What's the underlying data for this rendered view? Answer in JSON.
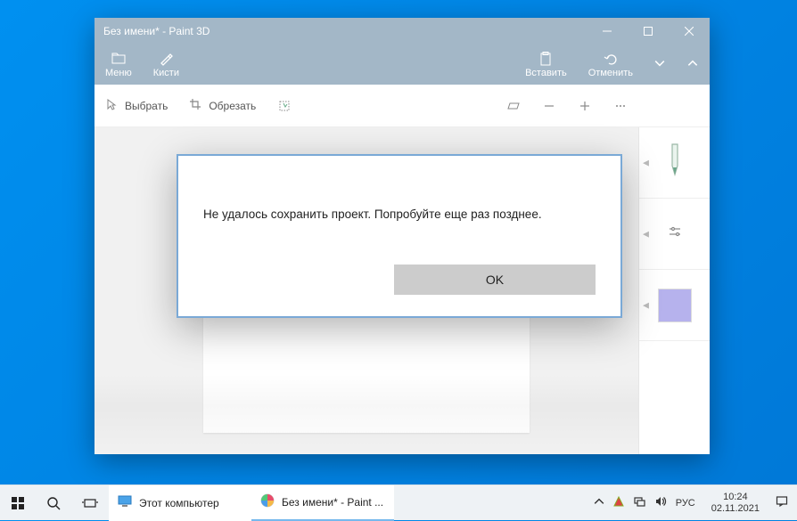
{
  "window": {
    "title": "Без имени* - Paint 3D"
  },
  "toolbar": {
    "menu": "Меню",
    "brushes": "Кисти",
    "paste": "Вставить",
    "undo": "Отменить"
  },
  "subbar": {
    "select": "Выбрать",
    "crop": "Обрезать"
  },
  "dialog": {
    "message": "Не удалось сохранить проект. Попробуйте еще раз позднее.",
    "ok": "OK"
  },
  "taskbar": {
    "explorer": "Этот компьютер",
    "paint3d": "Без имени* - Paint ...",
    "lang": "РУС",
    "time": "10:24",
    "date": "02.11.2021"
  }
}
